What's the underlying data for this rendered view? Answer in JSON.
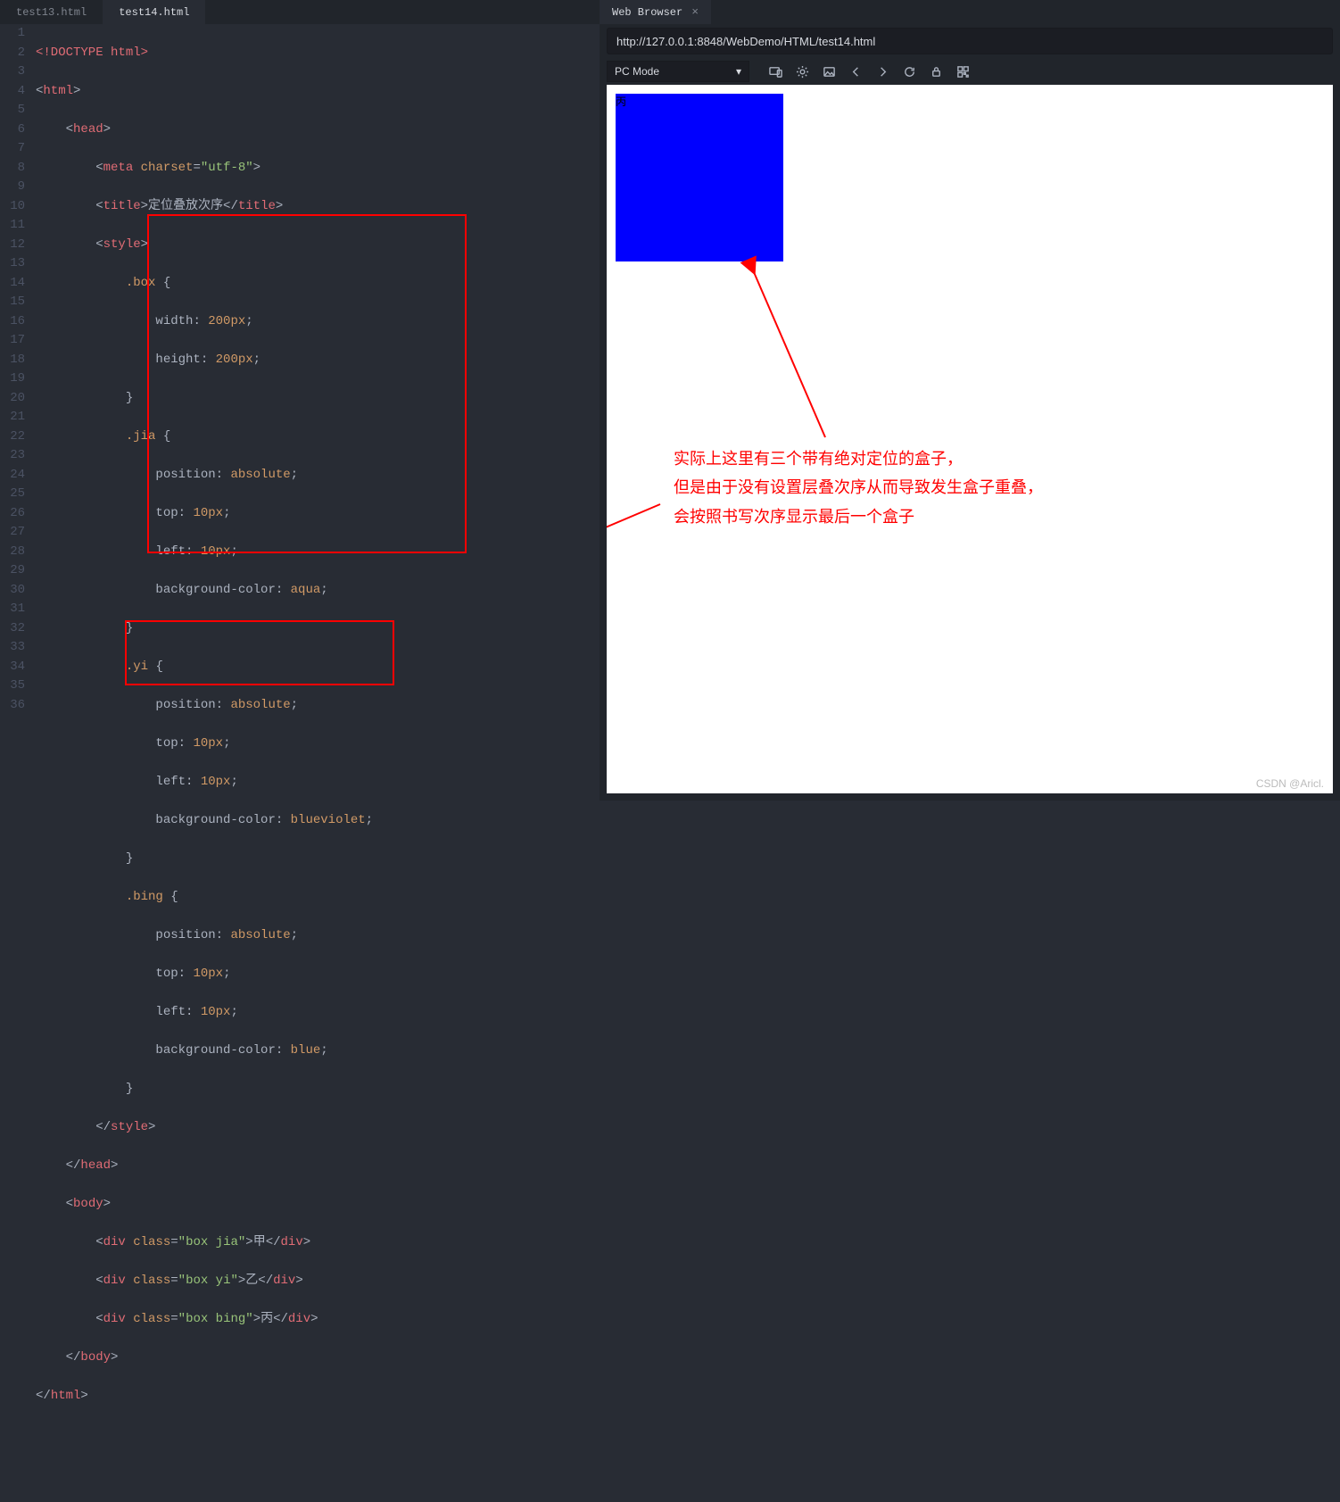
{
  "tabs": {
    "inactive": "test13.html",
    "active": "test14.html"
  },
  "gutter": [
    "1",
    "2",
    "3",
    "4",
    "5",
    "6",
    "7",
    "8",
    "9",
    "10",
    "11",
    "12",
    "13",
    "14",
    "15",
    "16",
    "17",
    "18",
    "19",
    "20",
    "21",
    "22",
    "23",
    "24",
    "25",
    "26",
    "27",
    "28",
    "29",
    "30",
    "31",
    "32",
    "33",
    "34",
    "35",
    "36"
  ],
  "code": {
    "doctype": "<!DOCTYPE html>",
    "html_open": "html",
    "head_open": "head",
    "meta_tag": "meta",
    "meta_attr": "charset",
    "meta_val": "\"utf-8\"",
    "title_tag": "title",
    "title_text": "定位叠放次序",
    "style_tag": "style",
    "sel_box": ".box",
    "prop_width": "width",
    "val_200w": "200px",
    "prop_height": "height",
    "val_200h": "200px",
    "sel_jia": ".jia",
    "prop_position": "position",
    "val_absolute": "absolute",
    "prop_top": "top",
    "val_10t": "10px",
    "prop_left": "left",
    "val_10l": "10px",
    "prop_bg": "background-color",
    "val_aqua": "aqua",
    "sel_yi": ".yi",
    "val_bv": "blueviolet",
    "sel_bing": ".bing",
    "val_blue": "blue",
    "body_tag": "body",
    "div_tag": "div",
    "class_attr": "class",
    "class_jia": "\"box jia\"",
    "text_jia": "甲",
    "class_yi": "\"box yi\"",
    "text_yi": "乙",
    "class_bing": "\"box bing\"",
    "text_bing": "丙"
  },
  "browser": {
    "tab_label": "Web Browser",
    "url": "http://127.0.0.1:8848/WebDemo/HTML/test14.html",
    "mode": "PC Mode",
    "box_text": "丙"
  },
  "annotation": {
    "line1": "实际上这里有三个带有绝对定位的盒子，",
    "line2": "但是由于没有设置层叠次序从而导致发生盒子重叠，",
    "line3": "会按照书写次序显示最后一个盒子"
  },
  "watermark": "CSDN @Aricl."
}
